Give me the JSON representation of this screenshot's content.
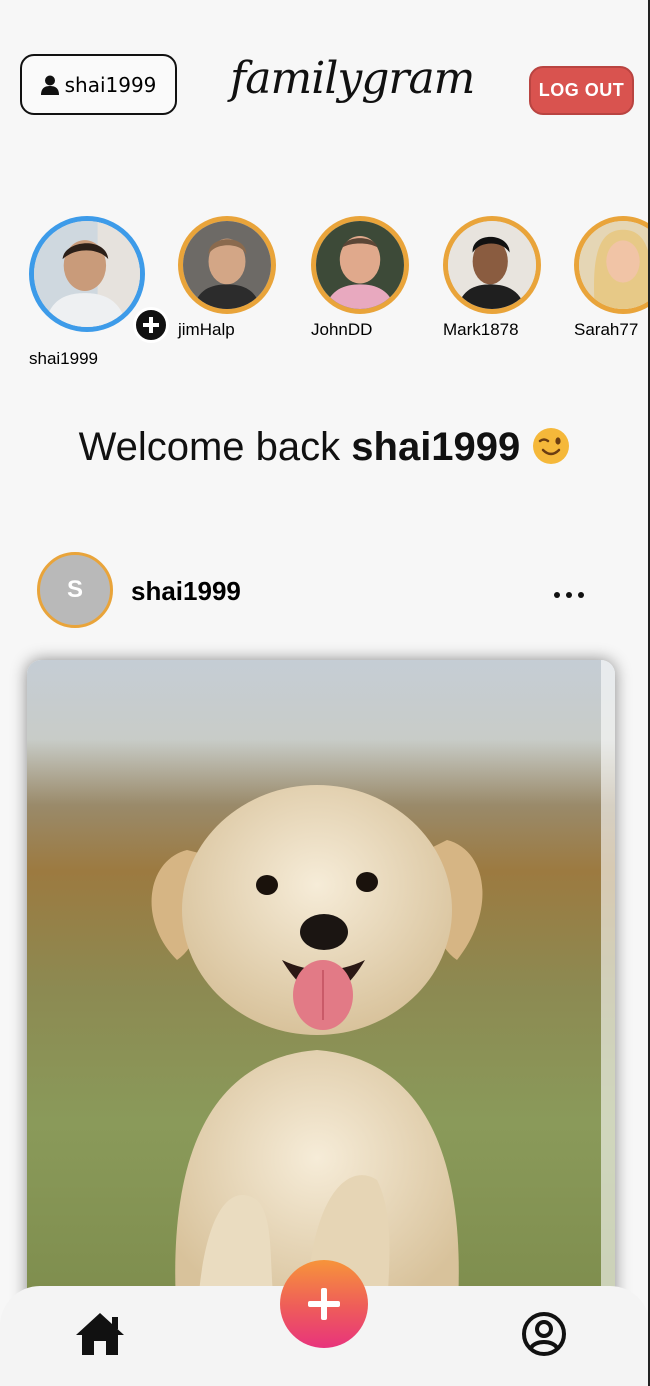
{
  "header": {
    "username": "shai1999",
    "logo": "familygram",
    "logout_label": "LOG OUT"
  },
  "stories": [
    {
      "name": "shai1999",
      "is_self": true
    },
    {
      "name": "jimHalp"
    },
    {
      "name": "JohnDD"
    },
    {
      "name": "Mark1878"
    },
    {
      "name": "Sarah77"
    }
  ],
  "welcome": {
    "prefix": "Welcome back ",
    "username": "shai1999",
    "emoji": "winking-face"
  },
  "post": {
    "avatar_letter": "S",
    "username": "shai1999",
    "image": "puppy-running-on-grass"
  },
  "nav": {
    "home_icon": "home-icon",
    "add_icon": "plus-icon",
    "profile_icon": "user-circle-icon"
  },
  "colors": {
    "logout": "#d9534f",
    "story_ring": "#e9a43a",
    "self_story_ring": "#3d9be9"
  }
}
